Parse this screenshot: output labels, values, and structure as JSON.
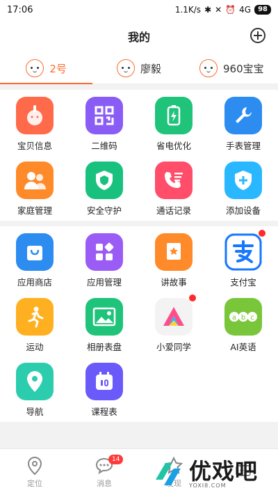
{
  "status": {
    "time": "17:06",
    "speed": "1.1K/s",
    "network": "4G",
    "battery": "98"
  },
  "header": {
    "title": "我的"
  },
  "children": [
    {
      "name": "2号",
      "active": true
    },
    {
      "name": "廖毅",
      "active": false
    },
    {
      "name": "960宝宝",
      "active": false
    }
  ],
  "section1": [
    {
      "label": "宝贝信息",
      "icon": "bunny-face-icon",
      "color": "#ff6b4a"
    },
    {
      "label": "二维码",
      "icon": "qr-code-icon",
      "color": "#8a5cf6"
    },
    {
      "label": "省电优化",
      "icon": "battery-bolt-icon",
      "color": "#1fc37a"
    },
    {
      "label": "手表管理",
      "icon": "wrench-icon",
      "color": "#2d8cf0"
    },
    {
      "label": "家庭管理",
      "icon": "family-icon",
      "color": "#ff8a2a"
    },
    {
      "label": "安全守护",
      "icon": "shield-icon",
      "color": "#19c17f"
    },
    {
      "label": "通话记录",
      "icon": "call-log-icon",
      "color": "#ff4d6a"
    },
    {
      "label": "添加设备",
      "icon": "add-device-icon",
      "color": "#29b8ff"
    }
  ],
  "section2": [
    {
      "label": "应用商店",
      "icon": "shopping-bag-icon",
      "color": "#2d8cf0"
    },
    {
      "label": "应用管理",
      "icon": "apps-grid-icon",
      "color": "#9b5cf6"
    },
    {
      "label": "讲故事",
      "icon": "story-book-icon",
      "color": "#ff8a2a"
    },
    {
      "label": "支付宝",
      "icon": "alipay-icon",
      "color": "#1677ff",
      "dot": true
    },
    {
      "label": "运动",
      "icon": "running-icon",
      "color": "#ffb020"
    },
    {
      "label": "相册表盘",
      "icon": "photo-icon",
      "color": "#1fc37a"
    },
    {
      "label": "小爱同学",
      "icon": "xiaoai-icon",
      "color": "#f3f3f3",
      "dot": true
    },
    {
      "label": "AI英语",
      "icon": "abc-icon",
      "color": "#7ac63a"
    },
    {
      "label": "导航",
      "icon": "location-pin-icon",
      "color": "#2ccdae"
    },
    {
      "label": "课程表",
      "icon": "calendar-icon",
      "color": "#6a5af9"
    }
  ],
  "tabs": [
    {
      "label": "定位",
      "icon": "location-icon"
    },
    {
      "label": "消息",
      "icon": "chat-icon",
      "badge": "14"
    },
    {
      "label": "发现",
      "icon": "star-icon"
    },
    {
      "label": "",
      "icon": "ai-face-icon"
    }
  ],
  "watermark": {
    "text": "优戏吧",
    "sub": "YOXI8.COM"
  }
}
